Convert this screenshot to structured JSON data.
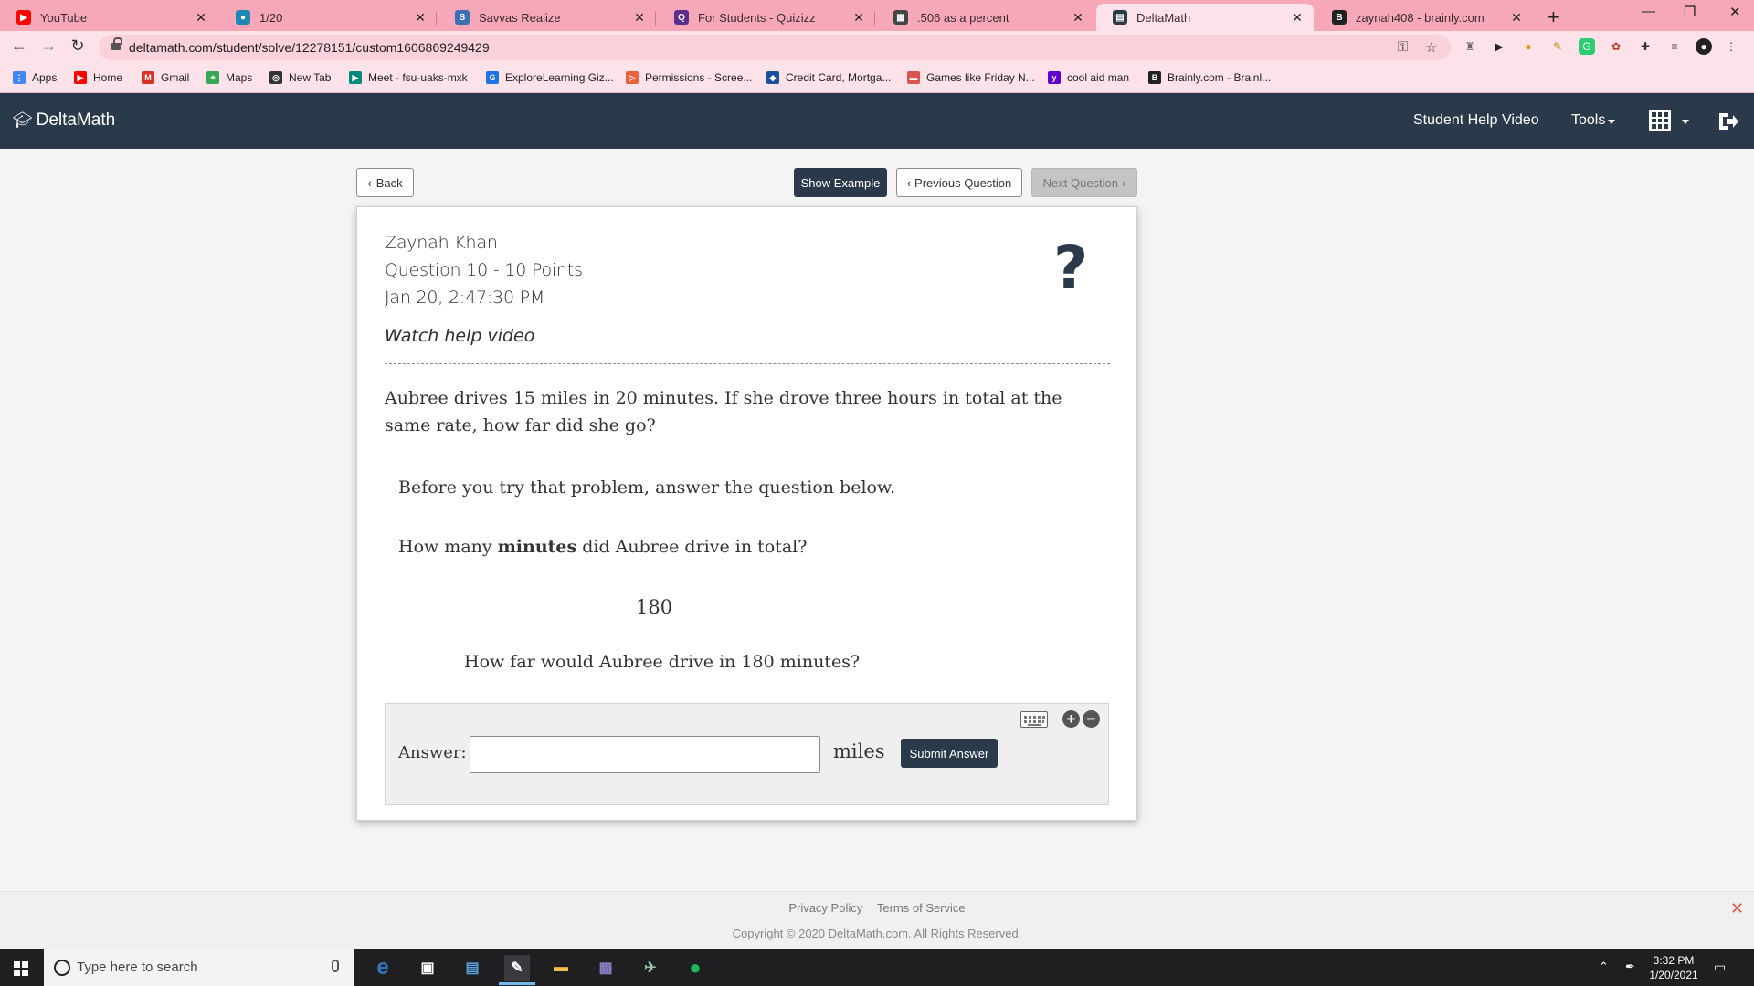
{
  "browser": {
    "tabs": [
      {
        "title": "YouTube",
        "favicon": "youtube-icon",
        "color": "#ff0000",
        "glyph": "▶"
      },
      {
        "title": "1/20",
        "favicon": "classroom-icon",
        "color": "#1e88b4",
        "glyph": "●"
      },
      {
        "title": "Savvas Realize",
        "favicon": "savvas-icon",
        "color": "#3b6fb6",
        "glyph": "S"
      },
      {
        "title": "For Students - Quizizz",
        "favicon": "quizizz-icon",
        "color": "#5c2d91",
        "glyph": "Q"
      },
      {
        "title": ".506 as a percent",
        "favicon": "calculator-icon",
        "color": "#444444",
        "glyph": "▦"
      },
      {
        "title": "DeltaMath",
        "favicon": "deltamath-icon",
        "color": "#2b3a4a",
        "glyph": "▤"
      },
      {
        "title": "zaynah408 - brainly.com",
        "favicon": "brainly-icon",
        "color": "#222222",
        "glyph": "B"
      }
    ],
    "url": "deltamath.com/student/solve/12278151/custom1606869249429",
    "bookmarks": [
      {
        "label": "Apps",
        "icon": "apps-grid-icon",
        "color": "#4285f4"
      },
      {
        "label": "Home",
        "icon": "youtube-icon",
        "color": "#ff0000"
      },
      {
        "label": "Gmail",
        "icon": "gmail-icon",
        "color": "#d93025"
      },
      {
        "label": "Maps",
        "icon": "maps-icon",
        "color": "#34a853"
      },
      {
        "label": "New Tab",
        "icon": "globe-icon",
        "color": "#333333"
      },
      {
        "label": "Meet - fsu-uaks-mxk",
        "icon": "meet-icon",
        "color": "#00897b"
      },
      {
        "label": "ExploreLearning Giz...",
        "icon": "gizmos-icon",
        "color": "#1a73e8"
      },
      {
        "label": "Permissions - Scree...",
        "icon": "screencastify-icon",
        "color": "#e8613c"
      },
      {
        "label": "Credit Card, Mortga...",
        "icon": "chase-icon",
        "color": "#1a4fa0"
      },
      {
        "label": "Games like Friday N...",
        "icon": "games-icon",
        "color": "#d9534f"
      },
      {
        "label": "cool aid man",
        "icon": "yahoo-icon",
        "color": "#6001d2"
      },
      {
        "label": "Brainly.com - Brainl...",
        "icon": "brainly-icon",
        "color": "#222222"
      }
    ]
  },
  "app": {
    "brand": "DeltaMath",
    "nav": {
      "help_video": "Student Help Video",
      "tools": "Tools"
    },
    "buttons": {
      "back": "Back",
      "show_example": "Show Example",
      "previous": "Previous Question",
      "next": "Next Question"
    },
    "problem": {
      "student_name": "Zaynah Khan",
      "question_info": "Question 10 - 10 Points",
      "timestamp": "Jan 20, 2:47:30 PM",
      "help_link": "Watch help video",
      "question_text": "Aubree drives 15 miles in 20 minutes. If she drove three hours in total at the same rate, how far did she go?",
      "sub_intro": "Before you try that problem, answer the question below.",
      "sub_q_before": "How many",
      "sub_q_bold": "minutes",
      "sub_q_after": "did Aubree drive in total?",
      "sub_answer": "180",
      "followup": "How far would Aubree drive in 180 minutes?",
      "answer_label": "Answer:",
      "answer_value": "",
      "unit": "miles",
      "submit": "Submit Answer"
    },
    "footer": {
      "privacy": "Privacy Policy",
      "terms": "Terms of Service",
      "copyright": "Copyright © 2020 DeltaMath.com. All Rights Reserved."
    }
  },
  "taskbar": {
    "search_placeholder": "Type here to search",
    "time": "3:32 PM",
    "date": "1/20/2021"
  },
  "colors": {
    "tabstrip": "#f7a8b8",
    "toolbar": "#fde3e9",
    "navbar": "#2b3a4a",
    "page_bg": "#f4f4f2"
  }
}
